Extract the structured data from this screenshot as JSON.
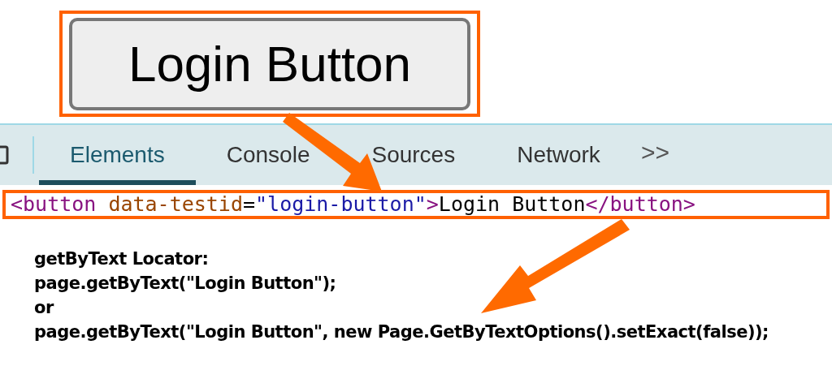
{
  "demo_button": {
    "label": "Login Button"
  },
  "devtools": {
    "tabs": [
      {
        "label": "Elements",
        "selected": true
      },
      {
        "label": "Console",
        "selected": false
      },
      {
        "label": "Sources",
        "selected": false
      },
      {
        "label": "Network",
        "selected": false
      }
    ],
    "more": ">>",
    "code_line": [
      {
        "kind": "tag",
        "text": "<button"
      },
      {
        "kind": "attr",
        "text": " data-testid"
      },
      {
        "kind": "plain",
        "text": "="
      },
      {
        "kind": "value",
        "text": "\"login-button\""
      },
      {
        "kind": "tag",
        "text": ">"
      },
      {
        "kind": "plain",
        "text": "Login Button"
      },
      {
        "kind": "tag",
        "text": "</button>"
      }
    ]
  },
  "explanation": [
    "getByText Locator:",
    "page.getByText(\"Login Button\");",
    "or",
    "page.getByText(\"Login Button\", new Page.GetByTextOptions().setExact(false));"
  ]
}
